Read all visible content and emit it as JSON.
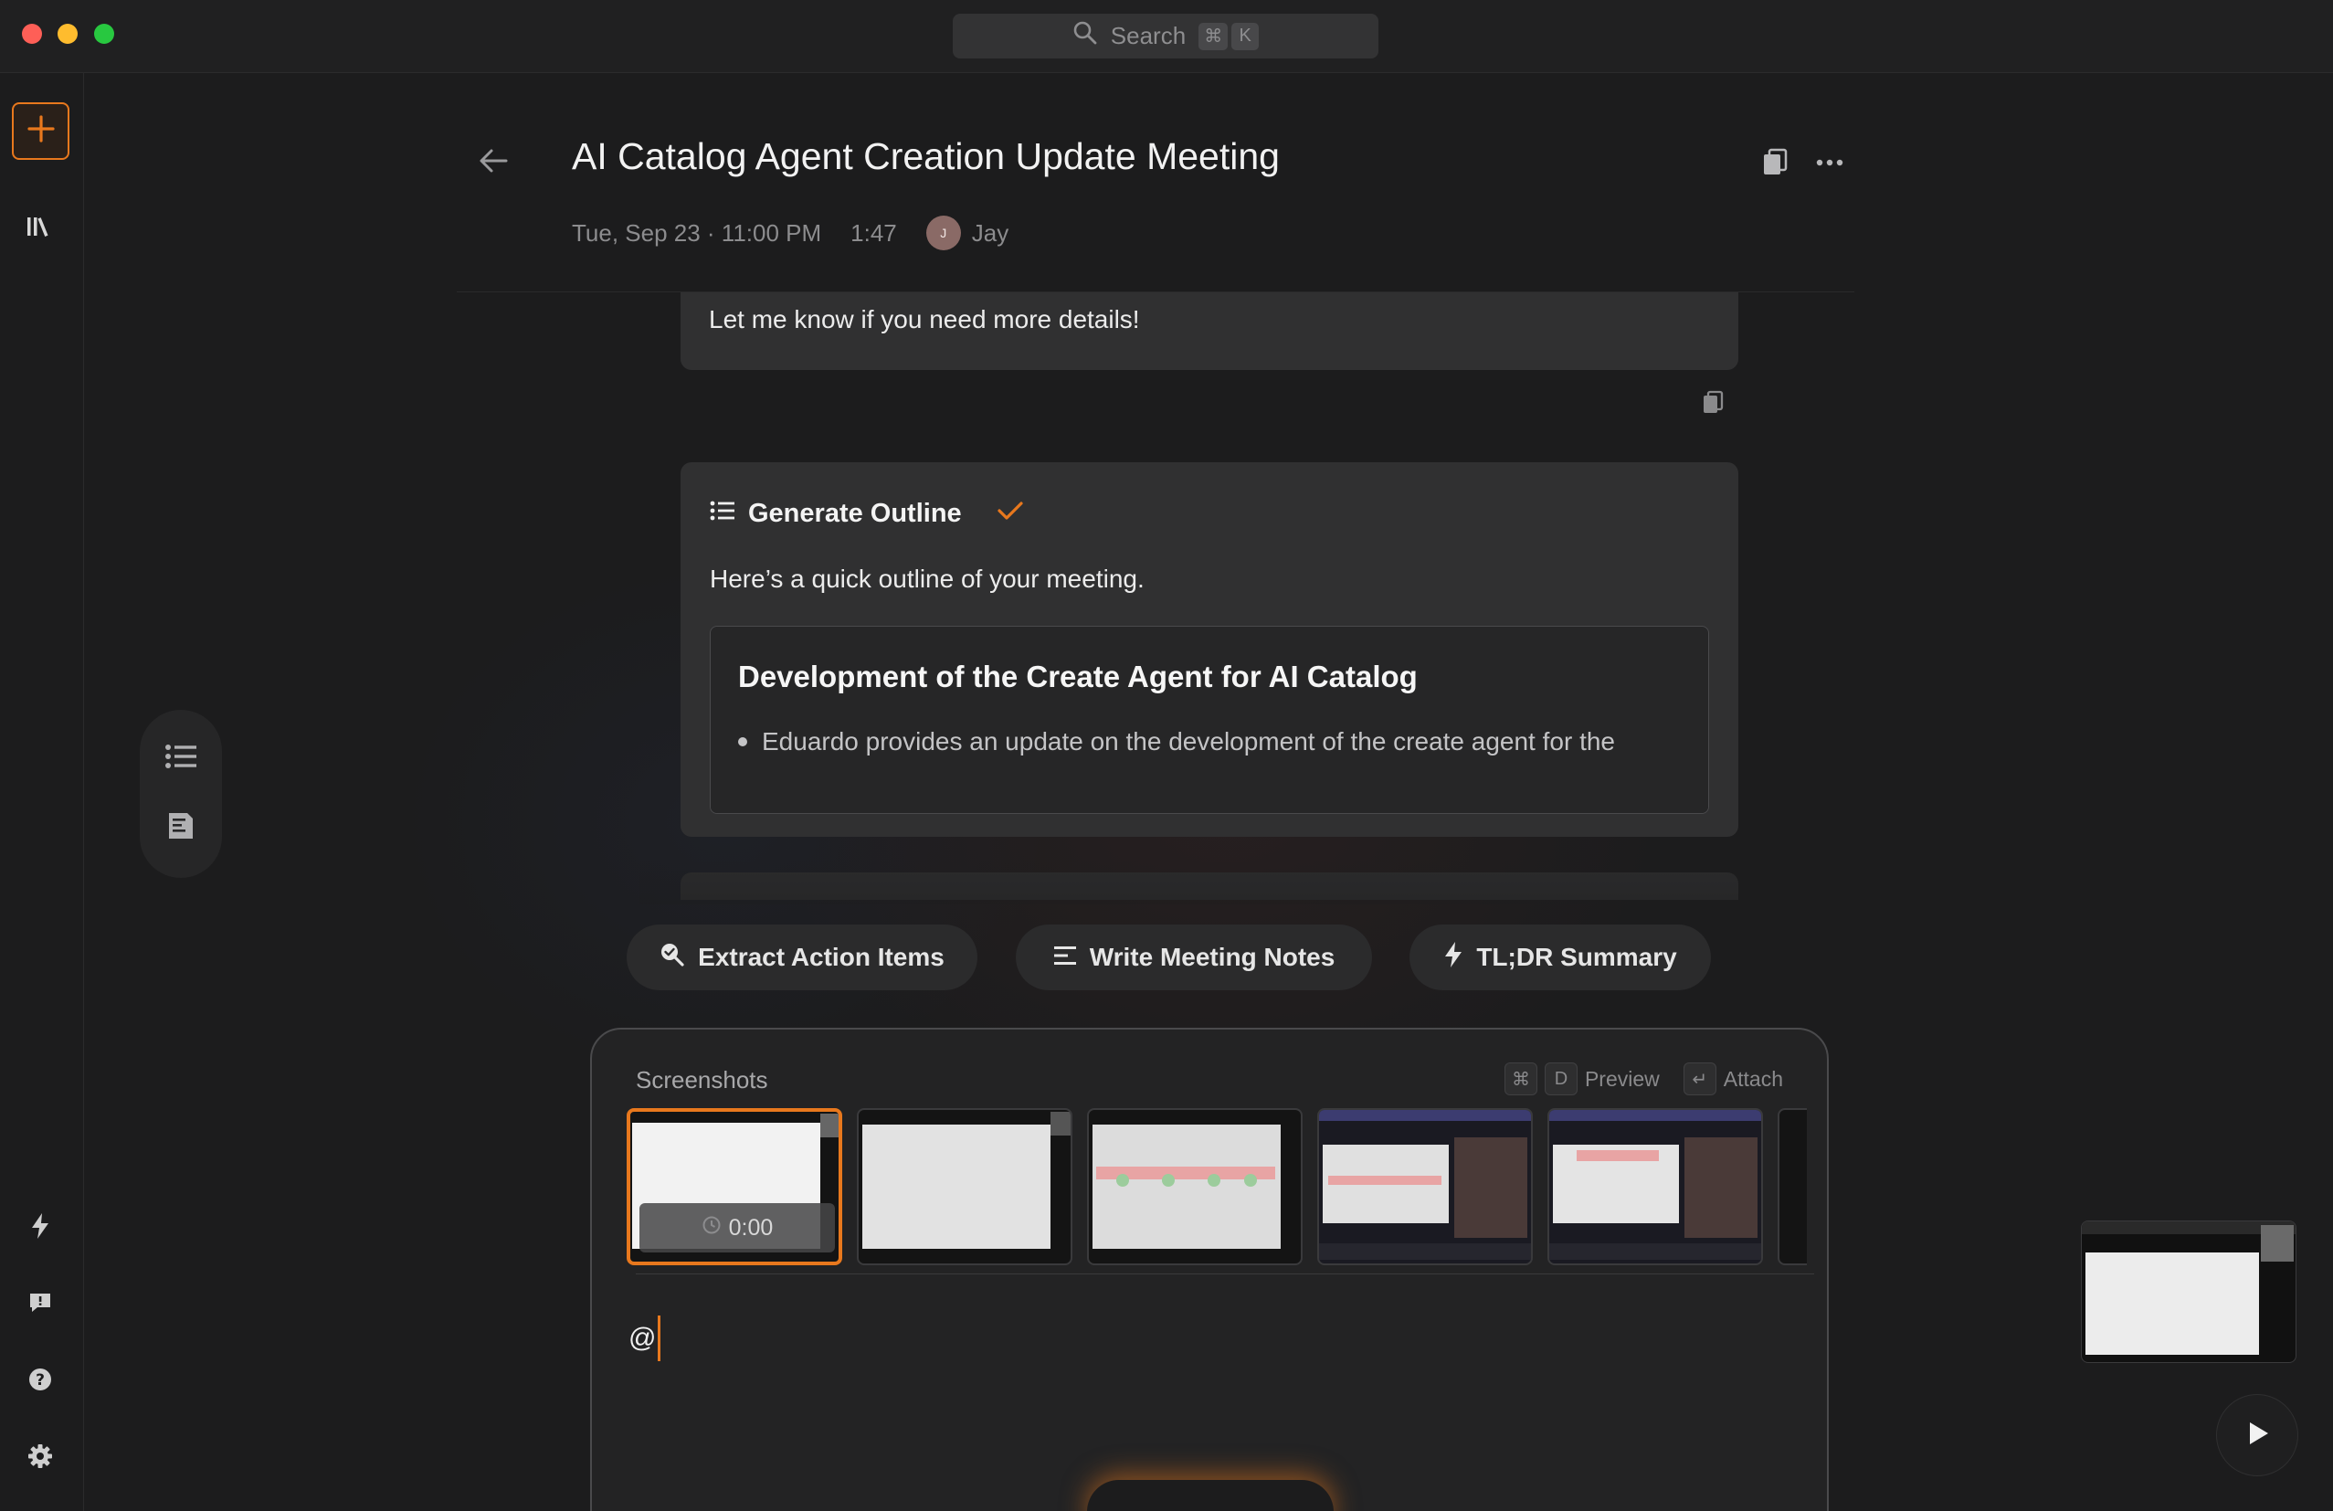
{
  "app": {
    "search_placeholder": "Search",
    "search_shortcut": [
      "⌘",
      "K"
    ]
  },
  "sidebar": {
    "items": [
      {
        "icon": "plus-icon",
        "accent": "#e8781d"
      },
      {
        "icon": "library-icon"
      },
      {
        "icon": "bolt-icon"
      },
      {
        "icon": "feedback-icon"
      },
      {
        "icon": "help-icon"
      },
      {
        "icon": "settings-icon"
      }
    ]
  },
  "meeting": {
    "title": "AI Catalog Agent Creation Update Meeting",
    "datetime": "Tue, Sep 23 · 11:00 PM",
    "duration": "1:47",
    "owner_initial": "J",
    "owner": "Jay"
  },
  "chat": {
    "previous_reply": "Let me know if you need more details!",
    "outline_card": {
      "title": "Generate Outline",
      "intro": "Here’s a quick outline of your meeting.",
      "section_title": "Development of the Create Agent for AI Catalog",
      "bullet": "Eduardo provides an update on the development of the create agent for the"
    }
  },
  "quick_actions": [
    {
      "label": "Extract Action Items",
      "icon": "search-check-icon"
    },
    {
      "label": "Write Meeting Notes",
      "icon": "notes-lines-icon"
    },
    {
      "label": "TL;DR Summary",
      "icon": "bolt-icon"
    }
  ],
  "composer": {
    "screenshots_label": "Screenshots",
    "preview_keys": [
      "⌘",
      "D"
    ],
    "preview_label": "Preview",
    "attach_key": "↵",
    "attach_label": "Attach",
    "selected_time": "0:00",
    "input_value": "@"
  },
  "colors": {
    "accent": "#e8781d",
    "background": "#1c1c1d",
    "card": "#303031"
  }
}
